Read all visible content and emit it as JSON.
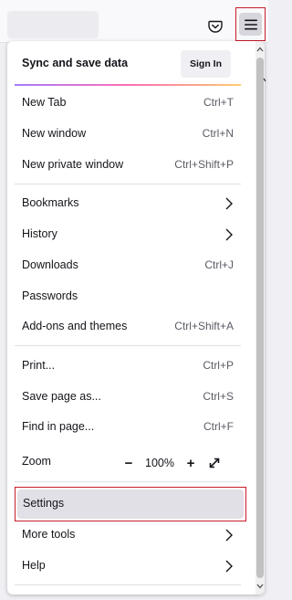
{
  "toolbar": {
    "pocket_icon": "pocket-icon",
    "menu_icon": "hamburger-menu-icon"
  },
  "menu": {
    "sync": {
      "label": "Sync and save data",
      "signin_label": "Sign In"
    },
    "items": [
      {
        "label": "New Tab",
        "shortcut": "Ctrl+T"
      },
      {
        "label": "New window",
        "shortcut": "Ctrl+N"
      },
      {
        "label": "New private window",
        "shortcut": "Ctrl+Shift+P"
      },
      {
        "label": "Bookmarks",
        "submenu": true
      },
      {
        "label": "History",
        "submenu": true
      },
      {
        "label": "Downloads",
        "shortcut": "Ctrl+J"
      },
      {
        "label": "Passwords"
      },
      {
        "label": "Add-ons and themes",
        "shortcut": "Ctrl+Shift+A"
      },
      {
        "label": "Print...",
        "shortcut": "Ctrl+P"
      },
      {
        "label": "Save page as...",
        "shortcut": "Ctrl+S"
      },
      {
        "label": "Find in page...",
        "shortcut": "Ctrl+F"
      }
    ],
    "zoom": {
      "label": "Zoom",
      "minus": "−",
      "value": "100%",
      "plus": "+"
    },
    "settings_label": "Settings",
    "more_tools_label": "More tools",
    "help_label": "Help"
  },
  "colors": {
    "highlight": "#c61c2a",
    "hover": "#e0e0e6"
  }
}
